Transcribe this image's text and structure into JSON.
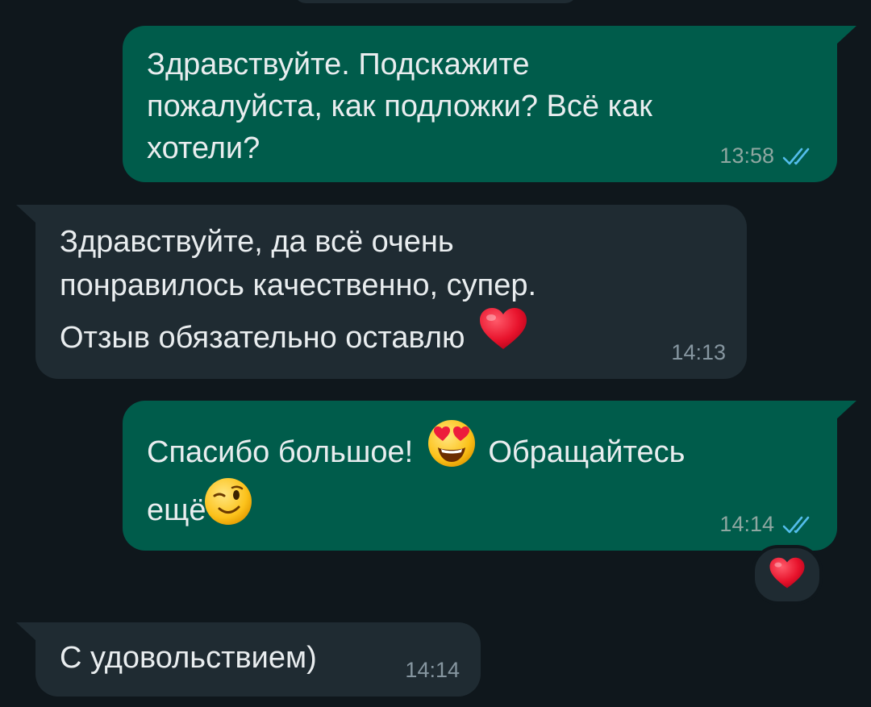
{
  "colors": {
    "background": "#0f171c",
    "outgoing_bubble": "#005c4b",
    "incoming_bubble": "#1f2b32",
    "message_text": "#e9edef",
    "read_ticks": "#53bdeb"
  },
  "messages": [
    {
      "direction": "outgoing",
      "lines": [
        "Здравствуйте. Подскажите",
        "пожалуйста, как подложки? Всё как",
        "хотели?"
      ],
      "time": "13:58",
      "status_icon": "double-check-read-icon"
    },
    {
      "direction": "incoming",
      "lines": [
        "Здравствуйте, да всё очень",
        "понравилось качественно, супер.",
        "Отзыв обязательно оставлю"
      ],
      "trailing_emoji": "red-heart-emoji",
      "time": "14:13"
    },
    {
      "direction": "outgoing",
      "lines": [
        "Спасибо большое!",
        "Обращайтесь",
        "ещё"
      ],
      "inline_emojis": [
        "heart-eyes-emoji",
        "winking-face-emoji"
      ],
      "time": "14:14",
      "status_icon": "double-check-read-icon",
      "reaction": "red-heart-emoji"
    },
    {
      "direction": "incoming",
      "lines": [
        "С удовольствием)"
      ],
      "time": "14:14"
    }
  ]
}
